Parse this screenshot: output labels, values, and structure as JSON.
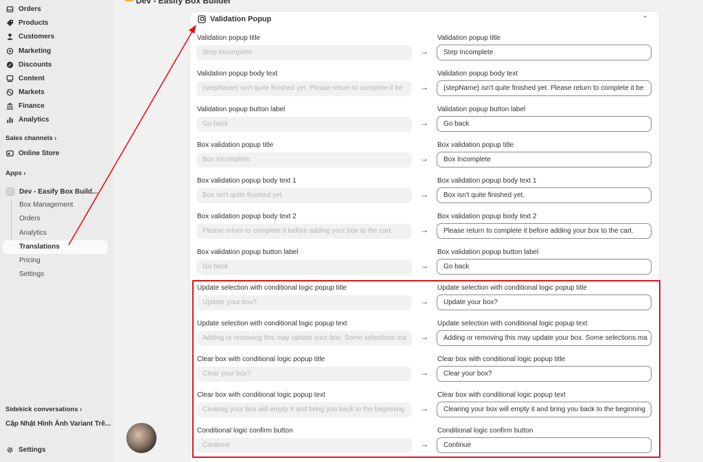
{
  "sidebar": {
    "main_items": [
      {
        "label": "Orders",
        "icon": "orders-icon"
      },
      {
        "label": "Products",
        "icon": "tag-icon"
      },
      {
        "label": "Customers",
        "icon": "person-icon"
      },
      {
        "label": "Marketing",
        "icon": "target-icon"
      },
      {
        "label": "Discounts",
        "icon": "discount-icon"
      },
      {
        "label": "Content",
        "icon": "content-icon"
      },
      {
        "label": "Markets",
        "icon": "globe-icon"
      },
      {
        "label": "Finance",
        "icon": "bank-icon"
      },
      {
        "label": "Analytics",
        "icon": "bar-chart-icon"
      }
    ],
    "sales_channels_label": "Sales channels",
    "online_store_label": "Online Store",
    "apps_label": "Apps",
    "app_name": "Dev - Easify Box Build...",
    "app_sub_items": [
      "Box Management",
      "Orders",
      "Analytics",
      "Translations",
      "Pricing",
      "Settings"
    ],
    "sidekick_label": "Sidekick conversations",
    "conversation_title": "Cập Nhật Hình Ảnh Variant Trê...",
    "settings_label": "Settings"
  },
  "breadcrumb": "Dev - Easify Box Builder",
  "card": {
    "title": "Validation Popup",
    "rows": [
      {
        "label": "Validation popup title",
        "placeholder": "Step Incomplete",
        "value": "Step Incomplete"
      },
      {
        "label": "Validation popup body text",
        "placeholder": "{stepName} isn't quite finished yet. Please return to complete it be",
        "value": "{stepName} isn't quite finished yet. Please return to complete it be"
      },
      {
        "label": "Validation popup button label",
        "placeholder": "Go back",
        "value": "Go back"
      },
      {
        "label": "Box validation popup title",
        "placeholder": "Box Incomplete",
        "value": "Box Incomplete"
      },
      {
        "label": "Box validation popup body text 1",
        "placeholder": "Box isn't quite finished yet.",
        "value": "Box isn't quite finished yet."
      },
      {
        "label": "Box validation popup body text 2",
        "placeholder": " Please return to complete it before adding your box to the cart.",
        "value": " Please return to complete it before adding your box to the cart."
      },
      {
        "label": "Box validation popup button label",
        "placeholder": "Go back",
        "value": "Go back"
      },
      {
        "label": "Update selection with conditional logic popup title",
        "placeholder": "Update your box?",
        "value": "Update your box?"
      },
      {
        "label": "Update selection with conditional logic popup text",
        "placeholder": "Adding or removing this may update your box. Some selections ma",
        "value": "Adding or removing this may update your box. Some selections ma"
      },
      {
        "label": "Clear box with conditional logic popup title",
        "placeholder": "Clear your box?",
        "value": "Clear your box?"
      },
      {
        "label": "Clear box with conditional logic popup text",
        "placeholder": "Clearing your box will empty it and bring you back to the beginning",
        "value": "Clearing your box will empty it and bring you back to the beginning"
      },
      {
        "label": "Conditional logic confirm button",
        "placeholder": "Continue",
        "value": "Continue"
      }
    ]
  },
  "colors": {
    "highlight": "#e3101a",
    "sidebar_bg": "#ebebeb",
    "page_bg": "#f1f1f1"
  }
}
